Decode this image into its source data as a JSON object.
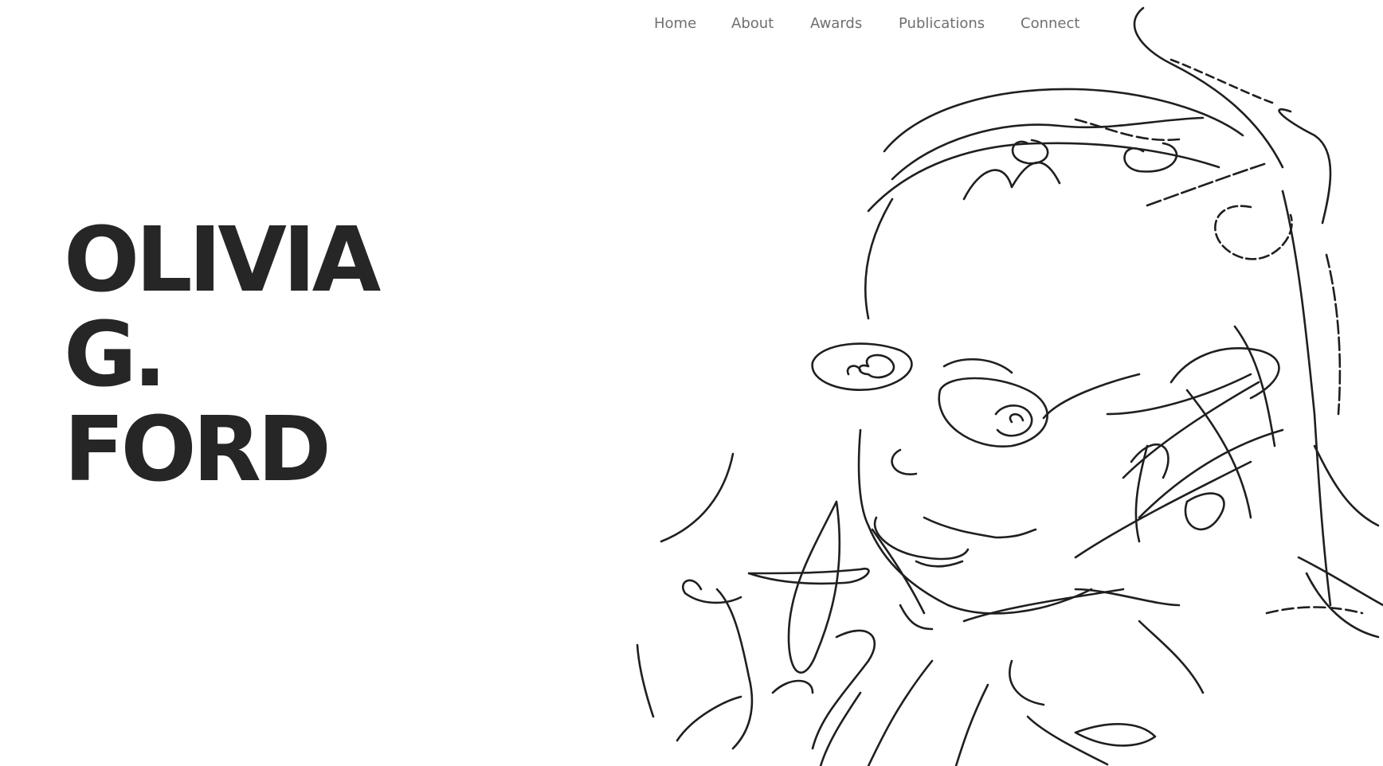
{
  "nav": {
    "items": [
      {
        "label": "Home"
      },
      {
        "label": "About"
      },
      {
        "label": "Awards"
      },
      {
        "label": "Publications"
      },
      {
        "label": "Connect"
      }
    ]
  },
  "hero": {
    "name_lines": [
      "OLIVIA",
      "G.",
      "FORD"
    ]
  },
  "portrait": {
    "icon": "line-drawing-portrait",
    "stroke_color": "#1f1f1f"
  }
}
